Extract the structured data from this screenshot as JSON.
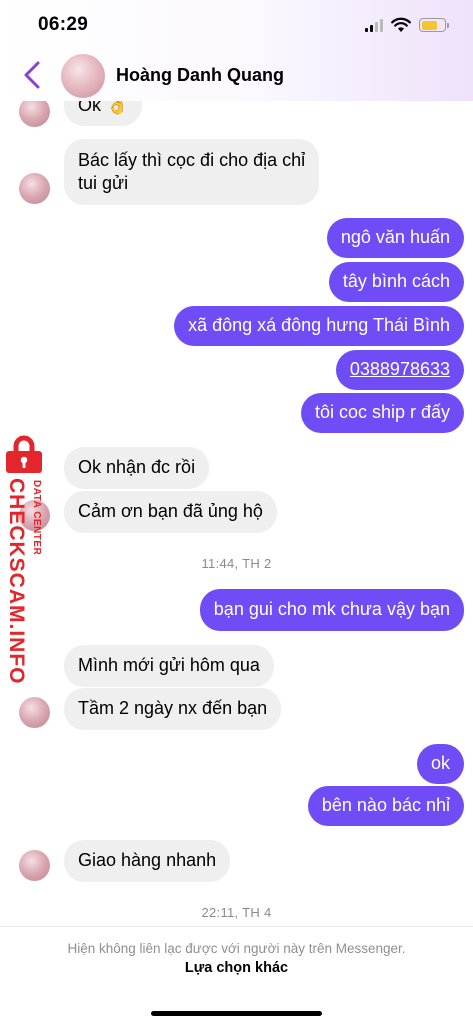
{
  "status_bar": {
    "time": "06:29"
  },
  "header": {
    "contact_name": "Hoàng Danh Quang",
    "accent_color": "#8b3fd9"
  },
  "messages": [
    {
      "side": "in",
      "text": "Ok 👌"
    },
    {
      "side": "in",
      "text": "Bác lấy thì cọc đi cho địa chỉ"
    },
    {
      "side": "in",
      "text": "tui gửi"
    },
    {
      "side": "out",
      "text": "ngô văn huấn"
    },
    {
      "side": "out",
      "text": "tây bình cách"
    },
    {
      "side": "out",
      "text": "xã đông xá đông hưng Thái Bình"
    },
    {
      "side": "out",
      "text": "0388978633"
    },
    {
      "side": "out",
      "text": "tôi coc ship r đấy"
    },
    {
      "side": "in",
      "text": "Ok nhận đc rồi"
    },
    {
      "side": "in",
      "text": "Cảm ơn bạn đã ủng hộ"
    },
    {
      "side": "out",
      "text": "bạn gui cho mk chưa vậy bạn"
    },
    {
      "side": "in",
      "text": "Mình mới gửi hôm qua"
    },
    {
      "side": "in",
      "text": "Tầm 2 ngày nx đến bạn"
    },
    {
      "side": "out",
      "text": "ok"
    },
    {
      "side": "out",
      "text": "bên nào bác nhỉ"
    },
    {
      "side": "in",
      "text": "Giao hàng nhanh"
    }
  ],
  "timestamps": [
    "11:44, TH 2",
    "22:11, TH 4"
  ],
  "watermark": {
    "main": "CHECKSCAM.INFO",
    "sub": "DATA CENTER"
  },
  "footer": {
    "note": "Hiện không liên lạc được với người này trên Messenger.",
    "action": "Lựa chọn khác"
  },
  "colors": {
    "outgoing_bubble": "#6f4cf5",
    "incoming_bubble": "#efefef",
    "watermark_red": "#e2262c"
  }
}
